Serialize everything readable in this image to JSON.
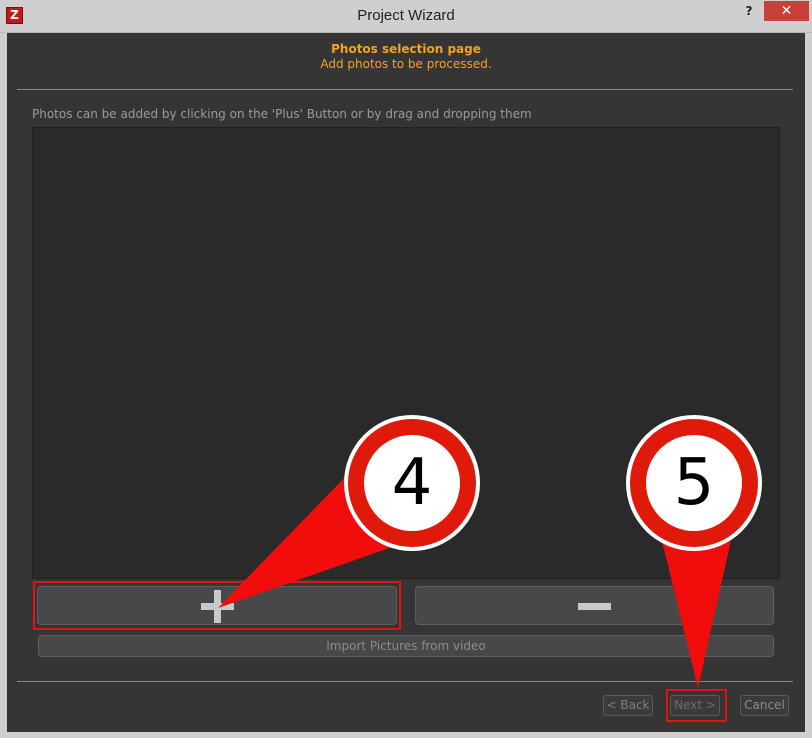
{
  "window": {
    "app_icon": "Z",
    "title": "Project Wizard",
    "help_label": "?",
    "close_label": "✕"
  },
  "header": {
    "title": "Photos selection page",
    "subtitle": "Add photos to be processed.",
    "color": "#f5a21b"
  },
  "main": {
    "hint": "Photos can be added by clicking on the 'Plus' Button or by drag and dropping them",
    "add_icon": "plus-icon",
    "remove_icon": "minus-icon",
    "import_label": "Import Pictures from video"
  },
  "footer": {
    "back_label": "< Back",
    "next_label": "Next >",
    "cancel_label": "Cancel"
  },
  "annotations": {
    "step_add": "4",
    "step_next": "5",
    "color": "#e01414"
  }
}
